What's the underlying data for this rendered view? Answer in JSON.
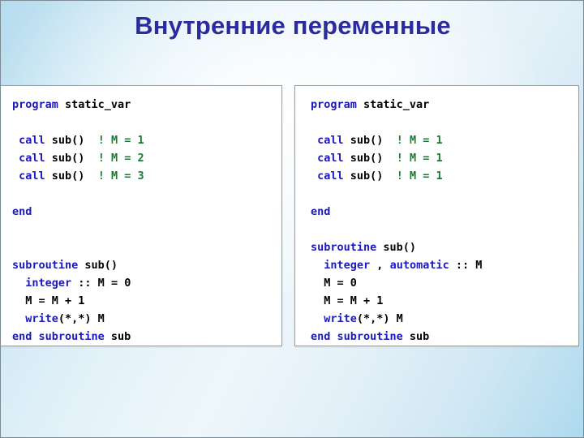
{
  "slide": {
    "title": "Внутренние переменные",
    "colors": {
      "title": "#2b2b9e",
      "keyword": "#1c18bf",
      "identifier": "#000000",
      "comment": "#1a7a31",
      "panel_background": "#ffffff",
      "panel_border": "#9e9e9e",
      "background_light": "#eef7fb",
      "background_blue": "#b6dcee"
    }
  },
  "panels": [
    {
      "name": "static-variable-example",
      "lines": [
        [
          {
            "t": "program ",
            "c": "kw"
          },
          {
            "t": "static_var",
            "c": "id"
          }
        ],
        [],
        [
          {
            "t": " call ",
            "c": "kw"
          },
          {
            "t": "sub()",
            "c": "id"
          },
          {
            "t": "  ",
            "c": "id"
          },
          {
            "t": "! M = 1",
            "c": "cm"
          }
        ],
        [
          {
            "t": " call ",
            "c": "kw"
          },
          {
            "t": "sub()",
            "c": "id"
          },
          {
            "t": "  ",
            "c": "id"
          },
          {
            "t": "! M = 2",
            "c": "cm"
          }
        ],
        [
          {
            "t": " call ",
            "c": "kw"
          },
          {
            "t": "sub()",
            "c": "id"
          },
          {
            "t": "  ",
            "c": "id"
          },
          {
            "t": "! M = 3",
            "c": "cm"
          }
        ],
        [],
        [
          {
            "t": "end",
            "c": "kw"
          }
        ],
        [],
        [],
        [
          {
            "t": "subroutine ",
            "c": "kw"
          },
          {
            "t": "sub()",
            "c": "id"
          }
        ],
        [
          {
            "t": "  ",
            "c": "id"
          },
          {
            "t": "integer",
            "c": "kw"
          },
          {
            "t": " :: M = 0",
            "c": "id"
          }
        ],
        [
          {
            "t": "  M = M + 1",
            "c": "id"
          }
        ],
        [
          {
            "t": "  ",
            "c": "id"
          },
          {
            "t": "write",
            "c": "kw"
          },
          {
            "t": "(*,*) M",
            "c": "id"
          }
        ],
        [
          {
            "t": "end subroutine ",
            "c": "kw"
          },
          {
            "t": "sub",
            "c": "id"
          }
        ]
      ]
    },
    {
      "name": "automatic-variable-example",
      "lines": [
        [
          {
            "t": "program ",
            "c": "kw"
          },
          {
            "t": "static_var",
            "c": "id"
          }
        ],
        [],
        [
          {
            "t": " call ",
            "c": "kw"
          },
          {
            "t": "sub()",
            "c": "id"
          },
          {
            "t": "  ",
            "c": "id"
          },
          {
            "t": "! M = 1",
            "c": "cm"
          }
        ],
        [
          {
            "t": " call ",
            "c": "kw"
          },
          {
            "t": "sub()",
            "c": "id"
          },
          {
            "t": "  ",
            "c": "id"
          },
          {
            "t": "! M = 1",
            "c": "cm"
          }
        ],
        [
          {
            "t": " call ",
            "c": "kw"
          },
          {
            "t": "sub()",
            "c": "id"
          },
          {
            "t": "  ",
            "c": "id"
          },
          {
            "t": "! M = 1",
            "c": "cm"
          }
        ],
        [],
        [
          {
            "t": "end",
            "c": "kw"
          }
        ],
        [],
        [
          {
            "t": "subroutine ",
            "c": "kw"
          },
          {
            "t": "sub()",
            "c": "id"
          }
        ],
        [
          {
            "t": "  ",
            "c": "id"
          },
          {
            "t": "integer",
            "c": "kw"
          },
          {
            "t": " , ",
            "c": "id"
          },
          {
            "t": "automatic",
            "c": "kw"
          },
          {
            "t": " :: M",
            "c": "id"
          }
        ],
        [
          {
            "t": "  M = 0",
            "c": "id"
          }
        ],
        [
          {
            "t": "  M = M + 1",
            "c": "id"
          }
        ],
        [
          {
            "t": "  ",
            "c": "id"
          },
          {
            "t": "write",
            "c": "kw"
          },
          {
            "t": "(*,*) M",
            "c": "id"
          }
        ],
        [
          {
            "t": "end subroutine ",
            "c": "kw"
          },
          {
            "t": "sub",
            "c": "id"
          }
        ]
      ]
    }
  ]
}
